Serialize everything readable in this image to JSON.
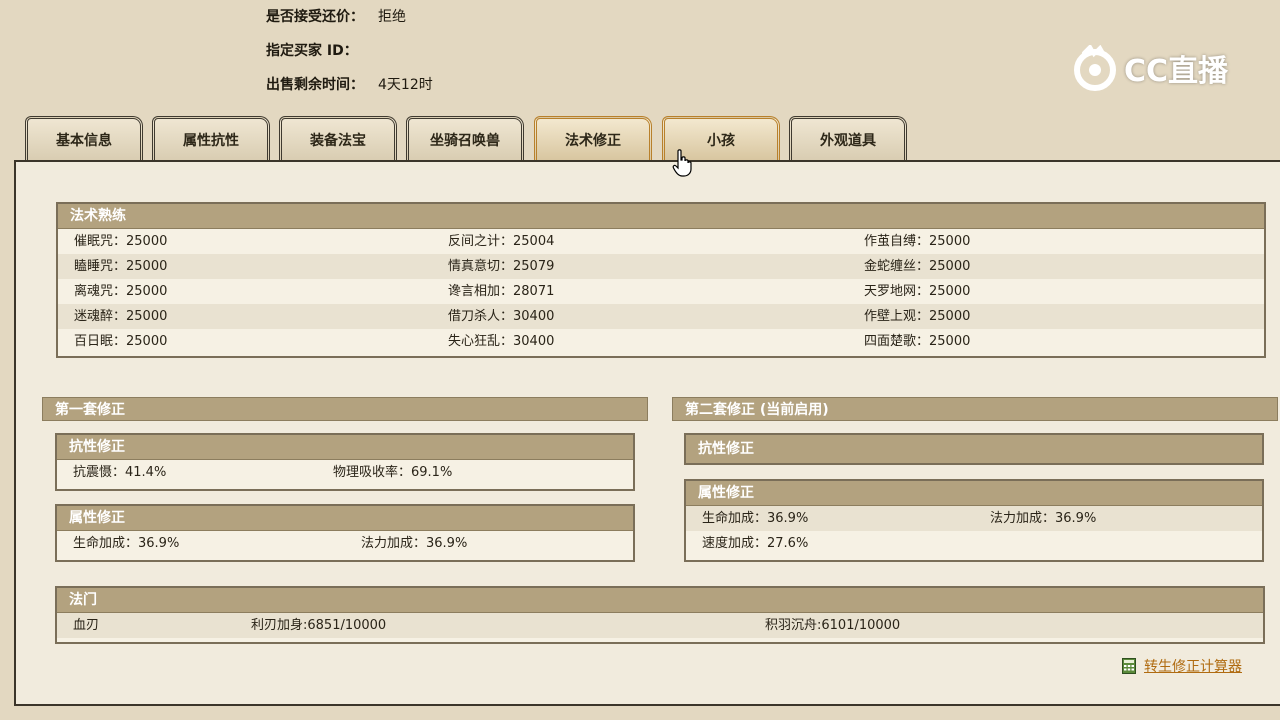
{
  "info": {
    "counter_offer_label": "是否接受还价：",
    "counter_offer_value": "拒绝",
    "buyer_id_label": "指定买家 ID：",
    "buyer_id_value": "",
    "time_left_label": "出售剩余时间：",
    "time_left_value": "4天12时"
  },
  "logo": {
    "text": "CC直播",
    "icon": "cc-live-logo-icon"
  },
  "tabs": [
    {
      "label": "基本信息",
      "active": false
    },
    {
      "label": "属性抗性",
      "active": false
    },
    {
      "label": "装备法宝",
      "active": false
    },
    {
      "label": "坐骑召唤兽",
      "active": false
    },
    {
      "label": "法术修正",
      "active": true
    },
    {
      "label": "小孩",
      "active": false,
      "hovered": true
    },
    {
      "label": "外观道具",
      "active": false
    }
  ],
  "mastery": {
    "title": "法术熟练",
    "rows": [
      [
        "催眠咒：25000",
        "反间之计：25004",
        "作茧自缚：25000"
      ],
      [
        "瞌睡咒：25000",
        "情真意切：25079",
        "金蛇缠丝：25000"
      ],
      [
        "离魂咒：25000",
        "谗言相加：28071",
        "天罗地网：25000"
      ],
      [
        "迷魂醉：25000",
        "借刀杀人：30400",
        "作壁上观：25000"
      ],
      [
        "百日眠：25000",
        "失心狂乱：30400",
        "四面楚歌：25000"
      ]
    ]
  },
  "set1": {
    "title": "第一套修正",
    "resist": {
      "title": "抗性修正",
      "items": [
        "抗震慑：41.4%",
        "物理吸收率：69.1%"
      ]
    },
    "attr": {
      "title": "属性修正",
      "items": [
        "生命加成：36.9%",
        "法力加成：36.9%"
      ]
    }
  },
  "set2": {
    "title": "第二套修正 (当前启用)",
    "resist": {
      "title": "抗性修正"
    },
    "attr": {
      "title": "属性修正",
      "items": [
        "生命加成：36.9%",
        "法力加成：36.9%",
        "速度加成：27.6%"
      ]
    }
  },
  "school": {
    "title": "法门",
    "items": [
      "血刃",
      "利刃加身:6851/10000",
      "积羽沉舟:6101/10000"
    ]
  },
  "calculator": {
    "label": "转生修正计算器",
    "icon": "calculator-icon"
  },
  "colors": {
    "header_bg": "#b3a27f",
    "panel_bg": "#f1ebdd",
    "page_bg": "#e3d8c1",
    "link": "#b06b10",
    "tab_highlight": "#b8802b"
  }
}
